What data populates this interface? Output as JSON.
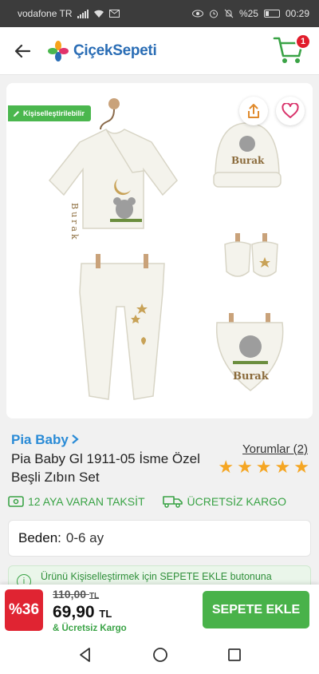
{
  "status_bar": {
    "carrier": "vodafone TR",
    "battery": "%25",
    "time": "00:29"
  },
  "header": {
    "logo_text": "ÇiçekSepeti",
    "cart_count": "1"
  },
  "product_image": {
    "ribbon": "Kişiselleştirilebilir",
    "personalized_name": "Burak"
  },
  "product": {
    "brand": "Pia Baby",
    "title": "Pia Baby Gl 1911-05 İsme Özel Beşli Zıbın Set",
    "reviews": "Yorumlar (2)",
    "rating": 5
  },
  "features": {
    "installment": "12 AYA VARAN TAKSİT",
    "shipping": "ÜCRETSİZ KARGO"
  },
  "size": {
    "label": "Beden:",
    "value": "0-6 ay"
  },
  "notice": {
    "text": "Ürünü Kişiselleştirmek için SEPETE EKLE butonuna"
  },
  "buy_bar": {
    "discount": "%36",
    "old_price": "110,00",
    "new_price": "69,90",
    "currency": "TL",
    "ship_note": "& Ücretsiz Kargo",
    "add_button": "SEPETE EKLE"
  },
  "colors": {
    "brand_blue": "#2a6db5",
    "green": "#49b24a",
    "discount_red": "#e02432",
    "star": "#f5a623"
  }
}
